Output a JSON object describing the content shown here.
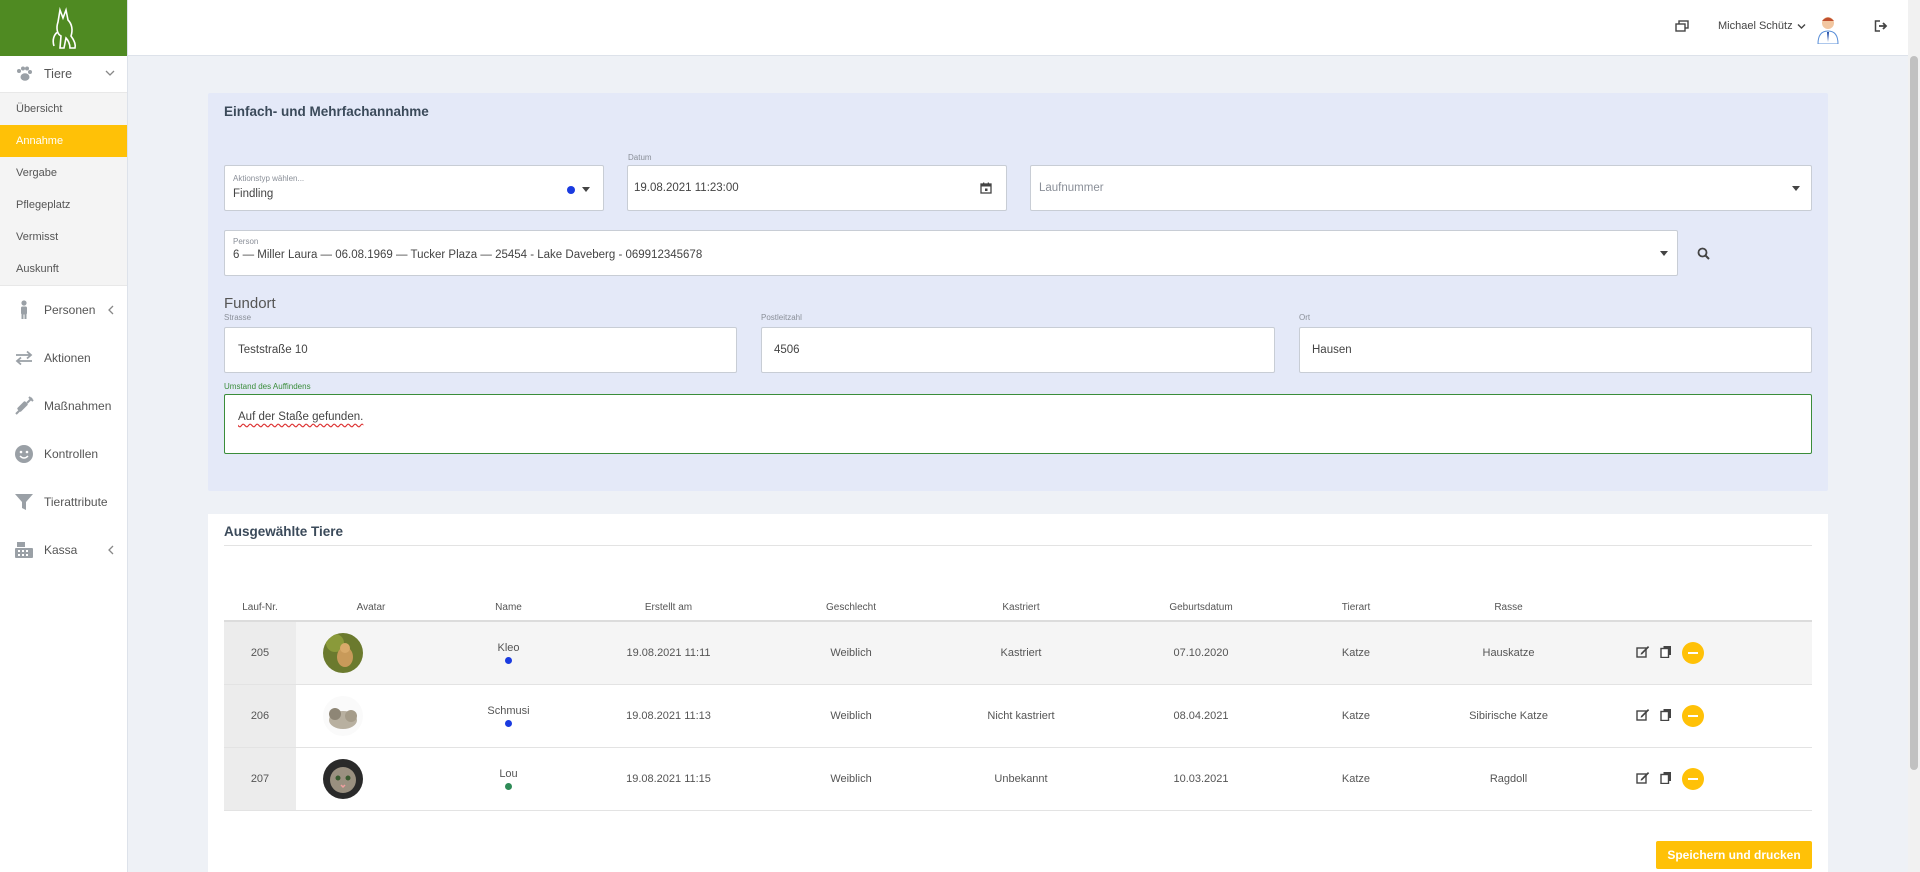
{
  "sidebar": {
    "items": [
      {
        "label": "Tiere",
        "icon": "paw-icon"
      },
      {
        "label": "Personen",
        "icon": "person-icon"
      },
      {
        "label": "Aktionen",
        "icon": "arrows-icon"
      },
      {
        "label": "Maßnahmen",
        "icon": "syringe-icon"
      },
      {
        "label": "Kontrollen",
        "icon": "smiley-icon"
      },
      {
        "label": "Tierattribute",
        "icon": "filter-icon"
      },
      {
        "label": "Kassa",
        "icon": "cash-register-icon"
      }
    ],
    "sub_items": [
      "Übersicht",
      "Annahme",
      "Vergabe",
      "Pflegeplatz",
      "Vermisst",
      "Auskunft"
    ],
    "active_sub": "Annahme",
    "active_color": "#ffc107",
    "brand_color": "#4f8a22"
  },
  "header": {
    "user_name": "Michael Schütz"
  },
  "form": {
    "title": "Einfach- und Mehrfachannahme",
    "aktionstyp": {
      "label": "Aktionstyp wählen...",
      "value": "Findling",
      "dot_color": "#1a3be0"
    },
    "datum": {
      "label": "Datum",
      "value": "19.08.2021 11:23:00"
    },
    "laufnummer": {
      "placeholder": "Laufnummer"
    },
    "person": {
      "label": "Person",
      "value": "6 — Miller Laura — 06.08.1969 — Tucker Plaza — 25454 - Lake Daveberg - 069912345678"
    },
    "fundort": {
      "title": "Fundort",
      "strasse": {
        "label": "Strasse",
        "value": "Teststraße 10"
      },
      "plz": {
        "label": "Postleitzahl",
        "value": "4506"
      },
      "ort": {
        "label": "Ort",
        "value": "Hausen"
      }
    },
    "umstand": {
      "label": "Umstand des Auffindens",
      "value": "Auf der Staße gefunden."
    }
  },
  "animals": {
    "title": "Ausgewählte Tiere",
    "columns": [
      "Lauf-Nr.",
      "Avatar",
      "Name",
      "Erstellt am",
      "Geschlecht",
      "Kastriert",
      "Geburtsdatum",
      "Tierart",
      "Rasse"
    ],
    "rows": [
      {
        "nr": "205",
        "name": "Kleo",
        "dot": "#1a3be0",
        "erstellt": "19.08.2021 11:11",
        "geschlecht": "Weiblich",
        "kastriert": "Kastriert",
        "geburt": "07.10.2020",
        "tierart": "Katze",
        "rasse": "Hauskatze"
      },
      {
        "nr": "206",
        "name": "Schmusi",
        "dot": "#1a3be0",
        "erstellt": "19.08.2021 11:13",
        "geschlecht": "Weiblich",
        "kastriert": "Nicht kastriert",
        "geburt": "08.04.2021",
        "tierart": "Katze",
        "rasse": "Sibirische Katze"
      },
      {
        "nr": "207",
        "name": "Lou",
        "dot": "#2e8b57",
        "erstellt": "19.08.2021 11:15",
        "geschlecht": "Weiblich",
        "kastriert": "Unbekannt",
        "geburt": "10.03.2021",
        "tierart": "Katze",
        "rasse": "Ragdoll"
      }
    ]
  },
  "actions": {
    "save_print": "Speichern und drucken"
  }
}
